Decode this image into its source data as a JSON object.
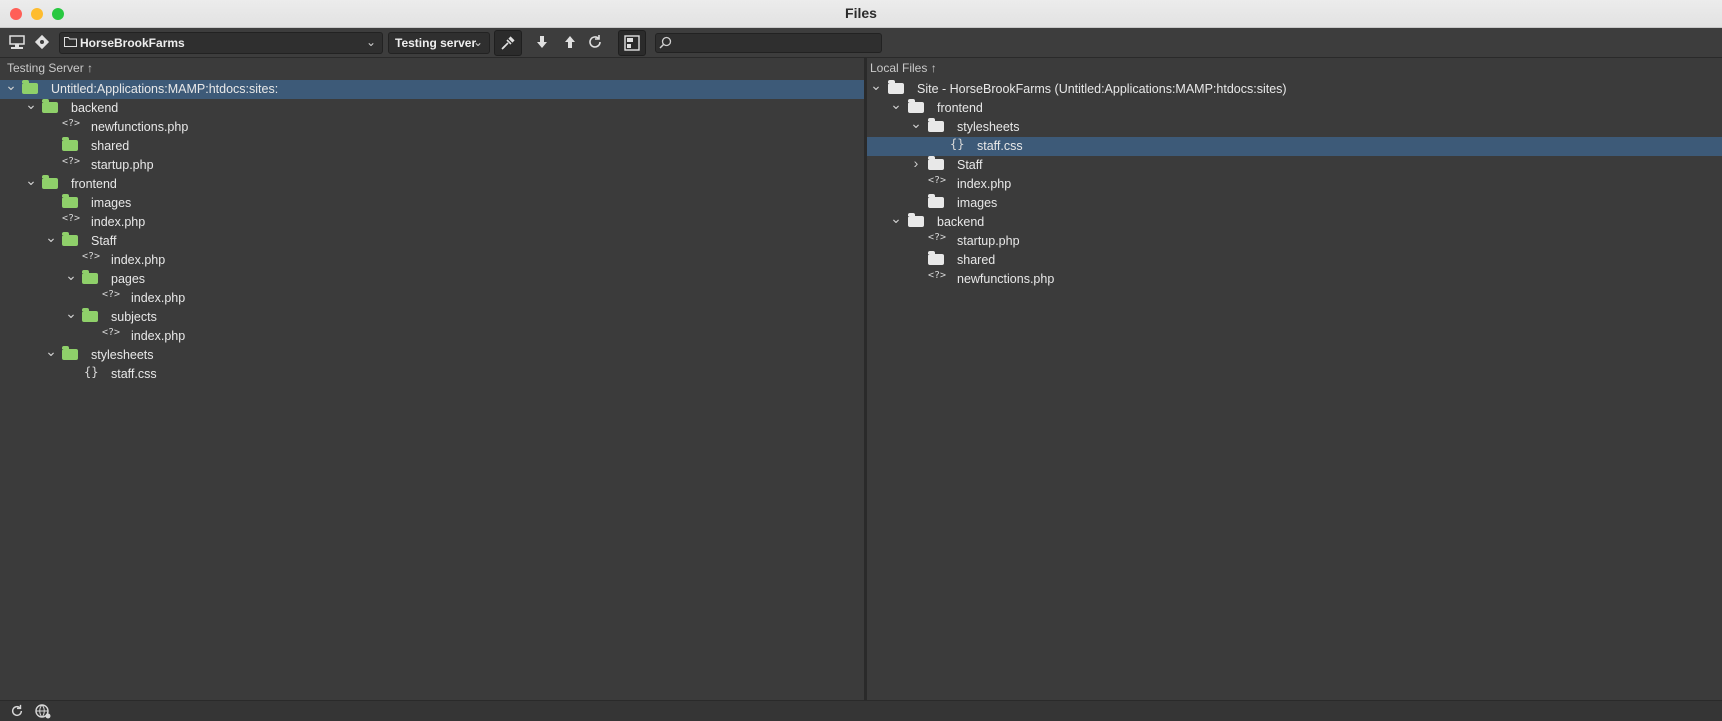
{
  "window": {
    "title": "Files"
  },
  "colors": {
    "close": "#ff5f57",
    "minimize": "#febc2e",
    "zoom": "#28c840",
    "selection": "#3d5a78",
    "server_folder": "#8fd06a",
    "local_folder": "#e8e8e8"
  },
  "toolbar": {
    "site": "HorseBrookFarms",
    "server": "Testing server",
    "search_placeholder": "",
    "icons": [
      "manage-sites-icon",
      "git-icon",
      "connect-icon",
      "get-download-icon",
      "put-upload-icon",
      "refresh-icon",
      "expand-view-icon",
      "search-icon"
    ]
  },
  "left": {
    "header": "Testing Server",
    "rows": [
      {
        "label": "Untitled:Applications:MAMP:htdocs:sites:",
        "depth": 0,
        "kind": "folder",
        "twisty": "open",
        "selected": true
      },
      {
        "label": "backend",
        "depth": 1,
        "kind": "folder",
        "twisty": "open"
      },
      {
        "label": "newfunctions.php",
        "depth": 2,
        "kind": "php"
      },
      {
        "label": "shared",
        "depth": 2,
        "kind": "folder"
      },
      {
        "label": "startup.php",
        "depth": 2,
        "kind": "php"
      },
      {
        "label": "frontend",
        "depth": 1,
        "kind": "folder",
        "twisty": "open"
      },
      {
        "label": "images",
        "depth": 2,
        "kind": "folder"
      },
      {
        "label": "index.php",
        "depth": 2,
        "kind": "php"
      },
      {
        "label": "Staff",
        "depth": 2,
        "kind": "folder",
        "twisty": "open"
      },
      {
        "label": "index.php",
        "depth": 3,
        "kind": "php"
      },
      {
        "label": "pages",
        "depth": 3,
        "kind": "folder",
        "twisty": "open"
      },
      {
        "label": "index.php",
        "depth": 4,
        "kind": "php"
      },
      {
        "label": "subjects",
        "depth": 3,
        "kind": "folder",
        "twisty": "open"
      },
      {
        "label": "index.php",
        "depth": 4,
        "kind": "php"
      },
      {
        "label": "stylesheets",
        "depth": 2,
        "kind": "folder",
        "twisty": "open"
      },
      {
        "label": "staff.css",
        "depth": 3,
        "kind": "css"
      }
    ]
  },
  "right": {
    "header": "Local Files",
    "rows": [
      {
        "label": "Site - HorseBrookFarms (Untitled:Applications:MAMP:htdocs:sites)",
        "depth": 0,
        "kind": "folder",
        "twisty": "open"
      },
      {
        "label": "frontend",
        "depth": 1,
        "kind": "folder",
        "twisty": "open"
      },
      {
        "label": "stylesheets",
        "depth": 2,
        "kind": "folder",
        "twisty": "open"
      },
      {
        "label": "staff.css",
        "depth": 3,
        "kind": "css",
        "selected": true
      },
      {
        "label": "Staff",
        "depth": 2,
        "kind": "folder",
        "twisty": "closed"
      },
      {
        "label": "index.php",
        "depth": 2,
        "kind": "php"
      },
      {
        "label": "images",
        "depth": 2,
        "kind": "folder"
      },
      {
        "label": "backend",
        "depth": 1,
        "kind": "folder",
        "twisty": "open"
      },
      {
        "label": "startup.php",
        "depth": 2,
        "kind": "php"
      },
      {
        "label": "shared",
        "depth": 2,
        "kind": "folder"
      },
      {
        "label": "newfunctions.php",
        "depth": 2,
        "kind": "php"
      }
    ]
  },
  "statusbar": {
    "icons": [
      "refresh-icon",
      "network-icon"
    ]
  }
}
